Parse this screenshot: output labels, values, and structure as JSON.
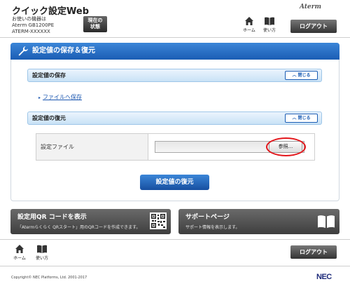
{
  "header": {
    "title": "クイック設定Web",
    "device_line1": "お使いの機器は",
    "device_line2": "Aterm GB1200PE",
    "device_line3": "ATERM-XXXXXX",
    "status_label_line1": "現在の",
    "status_label_line2": "状態",
    "brand": "Aterm",
    "home_label": "ホーム",
    "howto_label": "使い方",
    "logout_label": "ログアウト"
  },
  "main": {
    "title": "設定値の保存＆復元",
    "save_section": {
      "label": "設定値の保存",
      "close_label": "閉じる",
      "link_label": "ファイルへ保存"
    },
    "restore_section": {
      "label": "設定値の復元",
      "close_label": "閉じる",
      "file_label": "設定ファイル",
      "browse_label": "参照..."
    },
    "restore_button": "設定値の復元"
  },
  "banners": {
    "qr": {
      "title": "設定用QR コードを表示",
      "subtitle": "「Atermらくらく QRスタート」用のQRコードを作成できます。"
    },
    "support": {
      "title": "サポートページ",
      "subtitle": "サポート情報を表示します。"
    }
  },
  "footer": {
    "home_label": "ホーム",
    "howto_label": "使い方",
    "logout_label": "ログアウト",
    "copyright": "Copyright© NEC Platforms, Ltd. 2001-2017",
    "logo": "NEC"
  },
  "colors": {
    "accent_blue": "#1b5db4",
    "highlight_red": "#e3161b",
    "dark_button": "#3e3e3e"
  }
}
